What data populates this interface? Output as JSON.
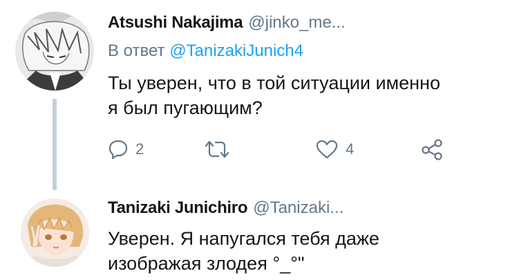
{
  "tweets": [
    {
      "display_name": "Atsushi Nakajima",
      "handle": "@jinko_me...",
      "reply_prefix": "В ответ ",
      "reply_mention": "@TanizakiJunich4",
      "text_lines": [
        "Ты уверен, что в той ситуации именно",
        "я был пугающим?"
      ],
      "reply_count": "2",
      "like_count": "4",
      "avatar_icon": "avatar-monochrome-anime-boy"
    },
    {
      "display_name": "Tanizaki Junichiro",
      "handle": "@Tanizaki...",
      "text_lines": [
        "Уверен. Я напугался тебя даже",
        "изображая злодея °_°\""
      ],
      "avatar_icon": "avatar-anime-boy-peace-sign"
    }
  ],
  "icons": {
    "reply": "reply-bubble-icon",
    "retweet": "retweet-icon",
    "like": "heart-icon",
    "share": "share-icon"
  },
  "colors": {
    "icon_gray": "#657786",
    "mention_blue": "#1da1f2",
    "thread_line": "#c4cfd6"
  }
}
